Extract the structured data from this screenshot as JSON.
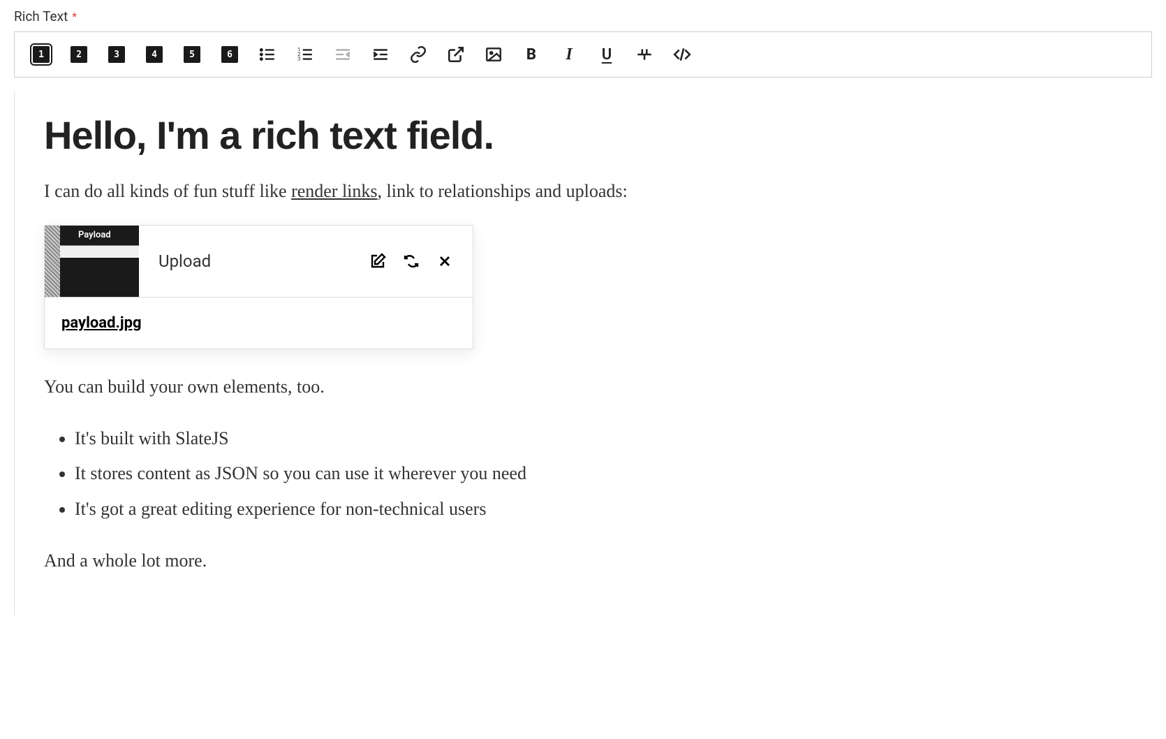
{
  "field": {
    "label": "Rich Text",
    "required_mark": "*"
  },
  "toolbar": {
    "headings": [
      "1",
      "2",
      "3",
      "4",
      "5",
      "6"
    ],
    "bold": "B",
    "italic": "I",
    "underline": "U"
  },
  "content": {
    "heading": "Hello, I'm a rich text field.",
    "para1_before": "I can do all kinds of fun stuff like ",
    "para1_link": "render links",
    "para1_after": ", link to relationships and uploads:",
    "upload": {
      "label": "Upload",
      "thumb_title": "Payload",
      "filename": "payload.jpg"
    },
    "para2": "You can build your own elements, too.",
    "bullets": [
      "It's built with SlateJS",
      "It stores content as JSON so you can use it wherever you need",
      "It's got a great editing experience for non-technical users"
    ],
    "para3": "And a whole lot more."
  }
}
